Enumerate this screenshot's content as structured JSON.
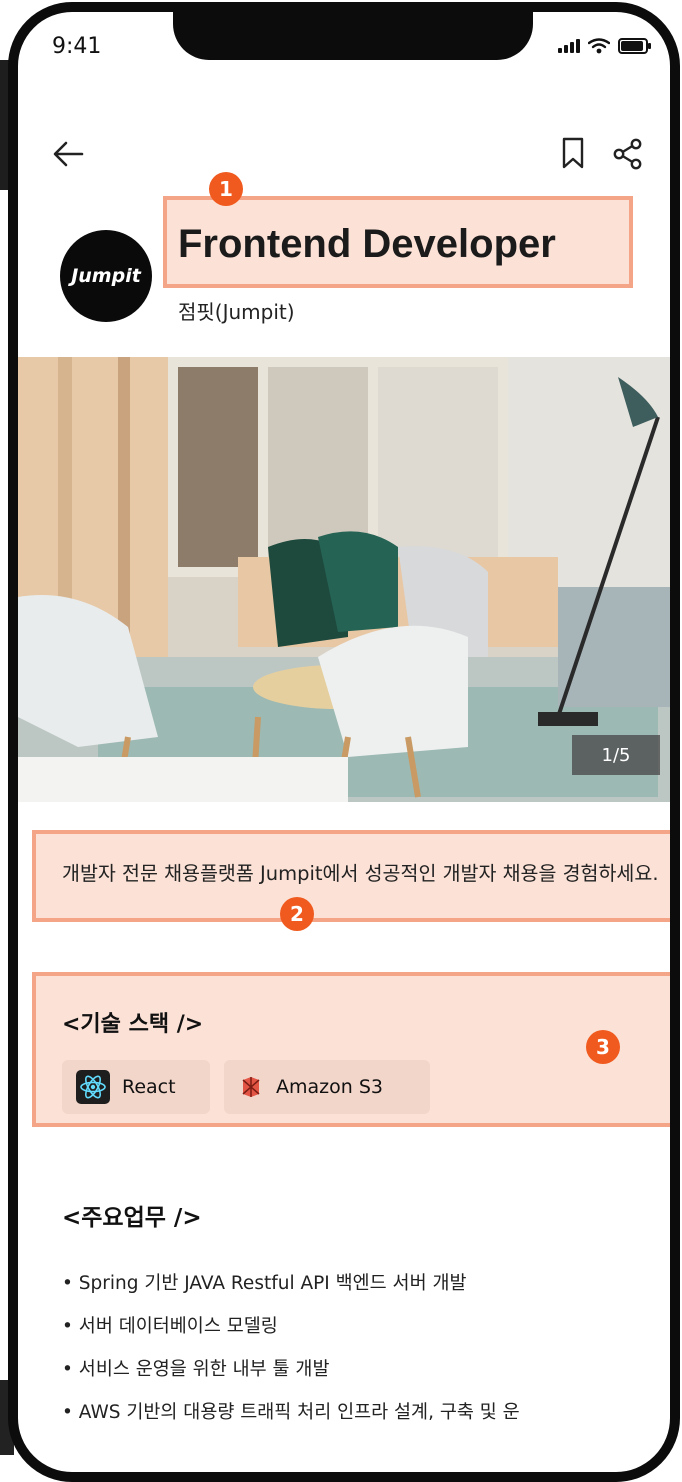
{
  "status_bar": {
    "time": "9:41"
  },
  "company": {
    "logo_text": "Jumpit",
    "name": "점핏(Jumpit)"
  },
  "job": {
    "title": "Frontend Developer"
  },
  "gallery": {
    "counter": "1/5"
  },
  "description": "개발자 전문 채용플랫폼 Jumpit에서 성공적인 개발자 채용을 경험하세요.",
  "tech_stack": {
    "heading": "<기술 스택 />",
    "items": [
      {
        "label": "React",
        "icon": "react-icon"
      },
      {
        "label": "Amazon S3",
        "icon": "amazon-s3-icon"
      }
    ]
  },
  "duties": {
    "heading": "<주요업무 />",
    "items": [
      "Spring 기반 JAVA Restful API 백엔드 서버 개발",
      "서버 데이터베이스 모델링",
      "서비스 운영을 위한 내부 툴 개발",
      "AWS 기반의 대용량 트래픽 처리 인프라 설계, 구축 및 운"
    ]
  },
  "annotations": [
    "1",
    "2",
    "3"
  ],
  "colors": {
    "highlight_fill": "#fbe1d6",
    "highlight_border": "#f4a487",
    "badge": "#f05a1e",
    "chip": "#f3d6ca"
  }
}
